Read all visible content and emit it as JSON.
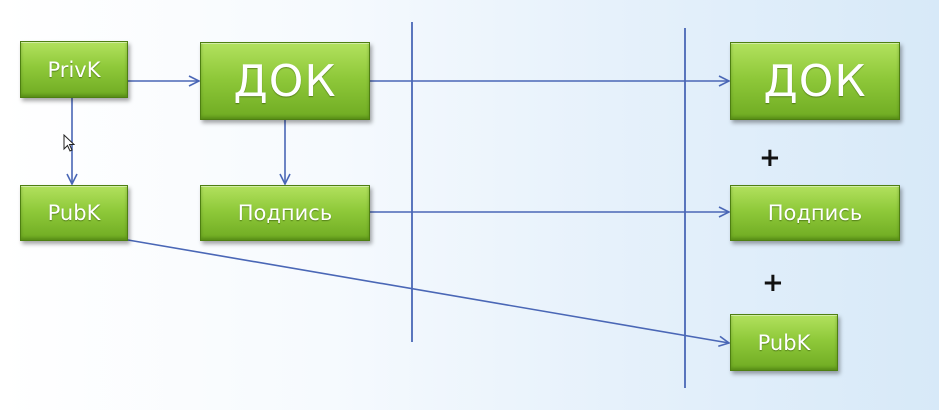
{
  "colors": {
    "box_green": "#8fc93a",
    "box_border": "#4e7f12",
    "line_blue": "#4a67b6",
    "text_white": "#ffffff"
  },
  "nodes": {
    "privk": {
      "label": "PrivK"
    },
    "pubk_left": {
      "label": "PubK"
    },
    "doc_left": {
      "label": "ДОК"
    },
    "sign_left": {
      "label": "Подпись"
    },
    "doc_right": {
      "label": "ДОК"
    },
    "sign_right": {
      "label": "Подпись"
    },
    "pubk_right": {
      "label": "PubK"
    }
  },
  "connectors": {
    "plus_1": "+",
    "plus_2": "+"
  },
  "edges": [
    {
      "from": "privk",
      "to": "doc_left"
    },
    {
      "from": "privk",
      "to": "pubk_left"
    },
    {
      "from": "doc_left",
      "to": "sign_left"
    },
    {
      "from": "doc_left",
      "to": "doc_right"
    },
    {
      "from": "sign_left",
      "to": "sign_right"
    },
    {
      "from": "pubk_left",
      "to": "pubk_right"
    }
  ],
  "icons": {
    "cursor": "mouse-pointer-icon"
  }
}
